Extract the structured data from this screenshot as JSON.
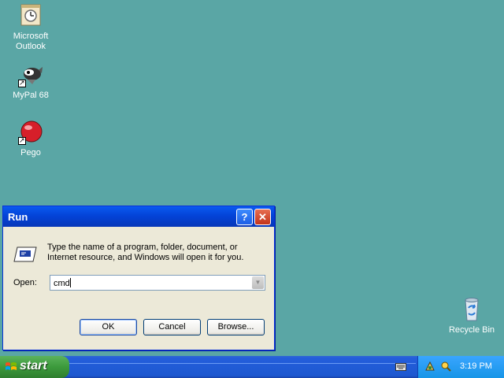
{
  "desktop": {
    "icons": [
      {
        "label_line1": "Microsoft",
        "label_line2": "Outlook",
        "icon": "outlook-icon"
      },
      {
        "label": "MyPal 68",
        "icon": "mypal-icon"
      },
      {
        "label": "Pego",
        "icon": "pego-icon"
      },
      {
        "label": "Recycle Bin",
        "icon": "recycle-bin-icon"
      }
    ]
  },
  "run_dialog": {
    "title": "Run",
    "help_label": "?",
    "close_label": "✕",
    "description": "Type the name of a program, folder, document, or Internet resource, and Windows will open it for you.",
    "open_label": "Open:",
    "open_value": "cmd",
    "ok_label": "OK",
    "cancel_label": "Cancel",
    "browse_label": "Browse..."
  },
  "taskbar": {
    "start_label": "start",
    "clock": "3:19 PM"
  },
  "colors": {
    "desktop": "#5aa6a5",
    "taskbar": "#245edb",
    "start": "#3c9a3c",
    "tray": "#1795e7"
  }
}
